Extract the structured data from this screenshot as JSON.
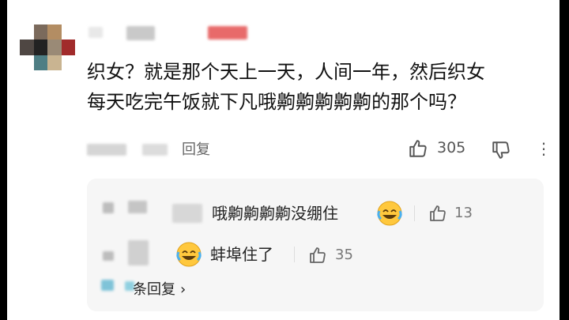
{
  "comment": {
    "text_line1": "织女？就是那个天上一天，人间一年，然后织女",
    "text_line2": "每天吃完午饭就下凡哦齁齁齁齁齁的那个吗？",
    "reply_label": "回复",
    "like_count": "305"
  },
  "replies": [
    {
      "text": "哦齁齁齁齁没绷住",
      "emoji": "laughing-crying-face",
      "like_count": "13"
    },
    {
      "text": "蚌埠住了",
      "emoji": "laughing-crying-face",
      "like_count": "35"
    }
  ],
  "more_replies_label": "条回复",
  "colors": {
    "accent_red": "#e86a6a",
    "icon_gray": "#555555",
    "reply_bg": "#f6f6f6",
    "emoji_yellow": "#ffc83d"
  }
}
